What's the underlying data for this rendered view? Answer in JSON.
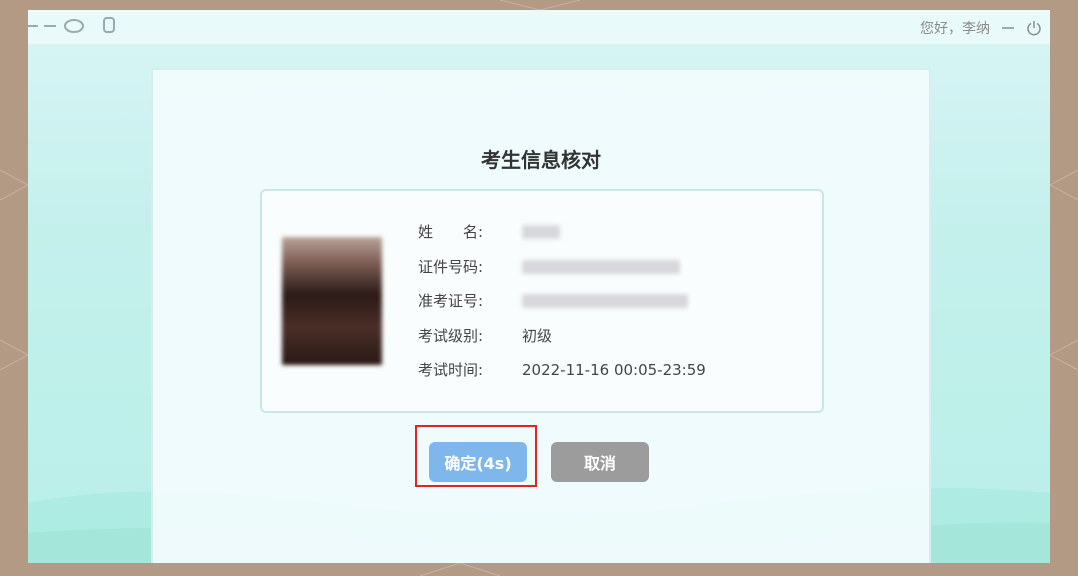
{
  "header": {
    "greeting": "您好，李纳",
    "minimize_icon": "minimize-icon",
    "power_icon": "power-icon"
  },
  "dialog": {
    "title": "考生信息核对",
    "fields": [
      {
        "label": "姓　　名:",
        "value": ""
      },
      {
        "label": "证件号码:",
        "value": ""
      },
      {
        "label": "准考证号:",
        "value": ""
      },
      {
        "label": "考试级别:",
        "value": "初级"
      },
      {
        "label": "考试时间:",
        "value": "2022-11-16 00:05-23:59"
      }
    ],
    "confirm_label": "确定(4s)",
    "cancel_label": "取消"
  },
  "colors": {
    "confirm": "#7fb7ec",
    "cancel": "#9c9c9c",
    "highlight": "#e02424",
    "frame": "#b39a85"
  }
}
